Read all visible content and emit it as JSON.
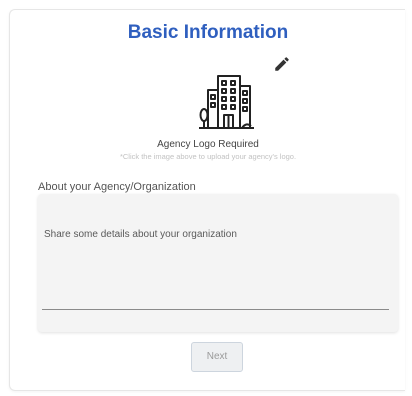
{
  "form": {
    "title": "Basic Information",
    "logo": {
      "icon": "building-icon",
      "required_label": "Agency Logo Required",
      "hint": "*Click the image above to upload your agency's logo."
    },
    "edit_icon": "pencil-icon",
    "about": {
      "label": "About your Agency/Organization",
      "placeholder": "Share some details about your organization",
      "value": ""
    },
    "next_label": "Next"
  },
  "colors": {
    "title": "#2f5fbf",
    "hint": "#c2c2c2",
    "field_background": "#f4f4f4",
    "next_button_background": "#eef0f2"
  }
}
